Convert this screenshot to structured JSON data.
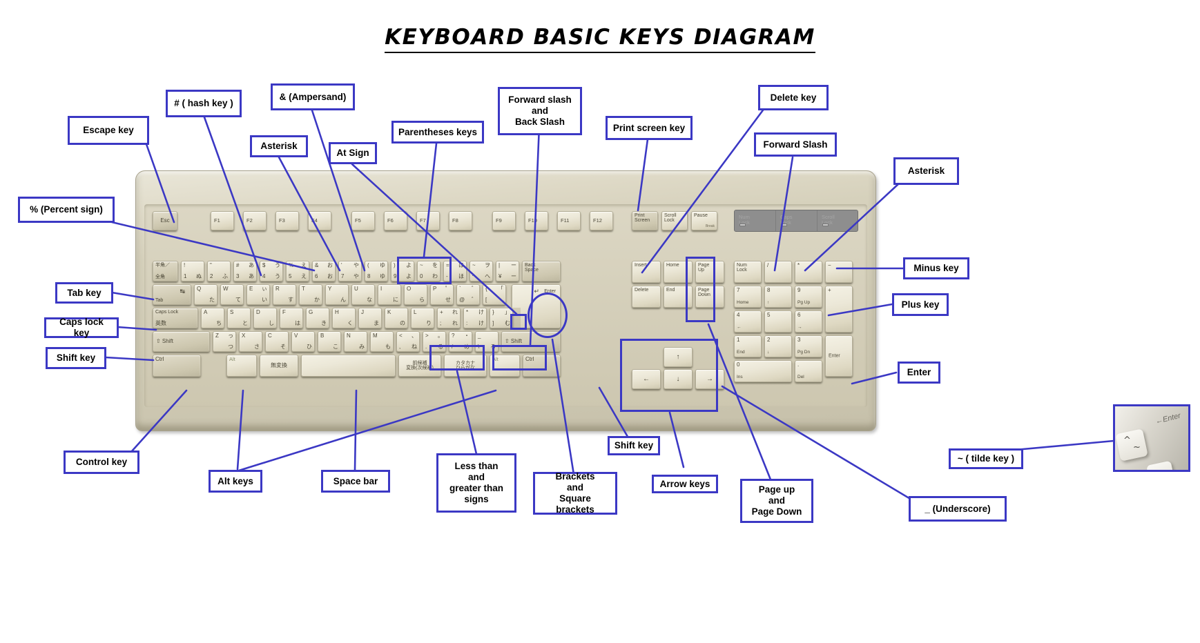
{
  "title": "KEYBOARD BASIC KEYS DIAGRAM",
  "diagram": {
    "subject": "Japanese 106-key beige desktop keyboard",
    "accent_color": "#3b38c4",
    "keyboard_color": "#d6d1bc",
    "key_color": "#ece8d8"
  },
  "labels": [
    {
      "id": "escape-key",
      "text": "Escape key"
    },
    {
      "id": "hash-key",
      "text": "# ( hash key )"
    },
    {
      "id": "ampersand",
      "text": "& (Ampersand)"
    },
    {
      "id": "asterisk-left",
      "text": "Asterisk"
    },
    {
      "id": "at-sign",
      "text": "At Sign"
    },
    {
      "id": "parentheses-keys",
      "text": "Parentheses keys"
    },
    {
      "id": "forward-back-slash",
      "text": "Forward slash\nand\nBack Slash"
    },
    {
      "id": "print-screen-key",
      "text": "Print screen key"
    },
    {
      "id": "delete-key",
      "text": "Delete key"
    },
    {
      "id": "forward-slash",
      "text": "Forward Slash"
    },
    {
      "id": "asterisk-right",
      "text": "Asterisk"
    },
    {
      "id": "percent-sign",
      "text": "% (Percent sign)"
    },
    {
      "id": "minus-key",
      "text": "Minus key"
    },
    {
      "id": "tab-key",
      "text": "Tab key"
    },
    {
      "id": "plus-key",
      "text": "Plus key"
    },
    {
      "id": "caps-lock-key",
      "text": "Caps lock key"
    },
    {
      "id": "shift-key-left",
      "text": "Shift key"
    },
    {
      "id": "enter-key",
      "text": "Enter"
    },
    {
      "id": "control-key",
      "text": "Control key"
    },
    {
      "id": "shift-key-right",
      "text": "Shift key"
    },
    {
      "id": "tilde-key",
      "text": "~ ( tilde key )"
    },
    {
      "id": "alt-keys",
      "text": "Alt keys"
    },
    {
      "id": "space-bar",
      "text": "Space bar"
    },
    {
      "id": "less-greater-than",
      "text": "Less than\nand\ngreater than\nsigns"
    },
    {
      "id": "brackets",
      "text": "Brackets\nand\nSquare brackets"
    },
    {
      "id": "arrow-keys",
      "text": "Arrow keys"
    },
    {
      "id": "page-up-down",
      "text": "Page up\nand\nPage Down"
    },
    {
      "id": "underscore",
      "text": "_ (Underscore)"
    }
  ],
  "keyboard": {
    "function_row": [
      {
        "label": "Esc"
      },
      {
        "label": "F1"
      },
      {
        "label": "F2"
      },
      {
        "label": "F3"
      },
      {
        "label": "F4"
      },
      {
        "label": "F5"
      },
      {
        "label": "F6"
      },
      {
        "label": "F7"
      },
      {
        "label": "F8"
      },
      {
        "label": "F9"
      },
      {
        "label": "F10"
      },
      {
        "label": "F11"
      },
      {
        "label": "F12"
      },
      {
        "label": "Print\nScreen"
      },
      {
        "label": "Scroll\nLock"
      },
      {
        "label": "Pause"
      }
    ],
    "pause_sublabel": "Break",
    "led_panel": [
      {
        "label": "Num\nLock"
      },
      {
        "label": "Caps\nLock"
      },
      {
        "label": "Scroll\nLock"
      }
    ],
    "number_row": [
      {
        "tl": "半角／",
        "bl": "全角"
      },
      {
        "tl": "!",
        "bl": "1",
        "br": "ぬ"
      },
      {
        "tl": "\"",
        "bl": "2",
        "br": "ふ"
      },
      {
        "tl": "#",
        "tr": "あ",
        "bl": "3",
        "br": "あ"
      },
      {
        "tl": "$",
        "tr": "う",
        "bl": "4",
        "br": "う"
      },
      {
        "tl": "%",
        "tr": "え",
        "bl": "5",
        "br": "え"
      },
      {
        "tl": "&",
        "tr": "お",
        "bl": "6",
        "br": "お"
      },
      {
        "tl": "'",
        "tr": "や",
        "bl": "7",
        "br": "や"
      },
      {
        "tl": "(",
        "tr": "ゆ",
        "bl": "8",
        "br": "ゆ"
      },
      {
        "tl": ")",
        "tr": "よ",
        "bl": "9",
        "br": "よ"
      },
      {
        "tl": "~",
        "tr": "を",
        "bl": "0",
        "br": "わ"
      },
      {
        "tl": "=",
        "tr": "ほ",
        "bl": "-",
        "br": "ほ"
      },
      {
        "tl": "~",
        "tr": "ヲ",
        "bl": "^",
        "br": "へ"
      },
      {
        "tl": "|",
        "tr": "ー",
        "bl": "¥",
        "br": "ー"
      },
      {
        "label": "Back\nSpace"
      }
    ],
    "tab_row": [
      {
        "label": "Tab"
      },
      {
        "tl": "Q",
        "br": "た"
      },
      {
        "tl": "W",
        "br": "て"
      },
      {
        "tl": "E",
        "tr": "ぃ",
        "br": "い"
      },
      {
        "tl": "R",
        "br": "す"
      },
      {
        "tl": "T",
        "br": "か"
      },
      {
        "tl": "Y",
        "br": "ん"
      },
      {
        "tl": "U",
        "br": "な"
      },
      {
        "tl": "I",
        "br": "に"
      },
      {
        "tl": "O",
        "br": "ら"
      },
      {
        "tl": "P",
        "tr": "゜",
        "br": "せ"
      },
      {
        "tl": "`",
        "tr": "゛",
        "bl": "@",
        "br": "゛"
      },
      {
        "tl": "{",
        "tr": "「",
        "bl": "[",
        "br": "゜"
      },
      {
        "label": "Enter"
      }
    ],
    "home_row": [
      {
        "label": "Caps Lock",
        "sub": "英数"
      },
      {
        "tl": "A",
        "br": "ち"
      },
      {
        "tl": "S",
        "br": "と"
      },
      {
        "tl": "D",
        "br": "し"
      },
      {
        "tl": "F",
        "br": "は"
      },
      {
        "tl": "G",
        "br": "き"
      },
      {
        "tl": "H",
        "br": "く"
      },
      {
        "tl": "J",
        "br": "ま"
      },
      {
        "tl": "K",
        "br": "の"
      },
      {
        "tl": "L",
        "br": "り"
      },
      {
        "tl": "+",
        "tr": "れ",
        "bl": ";",
        "br": "れ"
      },
      {
        "tl": "*",
        "tr": "け",
        "bl": ":",
        "br": "け"
      },
      {
        "tl": "}",
        "tr": "」",
        "bl": "]",
        "br": "む"
      }
    ],
    "shift_row": [
      {
        "label": "⇧ Shift"
      },
      {
        "tl": "Z",
        "tr": "っ",
        "br": "つ"
      },
      {
        "tl": "X",
        "br": "さ"
      },
      {
        "tl": "C",
        "br": "そ"
      },
      {
        "tl": "V",
        "br": "ひ"
      },
      {
        "tl": "B",
        "br": "こ"
      },
      {
        "tl": "N",
        "br": "み"
      },
      {
        "tl": "M",
        "br": "も"
      },
      {
        "tl": "<",
        "tr": "、",
        "bl": ",",
        "br": "ね"
      },
      {
        "tl": ">",
        "tr": "。",
        "bl": ".",
        "br": "る"
      },
      {
        "tl": "?",
        "tr": "・",
        "bl": "/",
        "br": "め"
      },
      {
        "tl": "_",
        "tr": "",
        "bl": "\\",
        "br": "ろ"
      },
      {
        "label": "⇧ Shift"
      }
    ],
    "bottom_row": [
      {
        "label": "Ctrl"
      },
      {
        "label": "Alt"
      },
      {
        "label": "無変換"
      },
      {
        "label": ""
      },
      {
        "label": "前候補\n変換(次候補)"
      },
      {
        "label": "カタカナ\nひらがな"
      },
      {
        "label": "Alt"
      },
      {
        "label": "Ctrl"
      }
    ],
    "nav_cluster": [
      {
        "label": "Insert"
      },
      {
        "label": "Home"
      },
      {
        "label": "Page\nUp"
      },
      {
        "label": "Delete"
      },
      {
        "label": "End"
      },
      {
        "label": "Page\nDown"
      }
    ],
    "arrow_cluster": [
      {
        "label": "↑"
      },
      {
        "label": "←"
      },
      {
        "label": "↓"
      },
      {
        "label": "→"
      }
    ],
    "numpad": [
      {
        "label": "Num\nLock"
      },
      {
        "label": "/"
      },
      {
        "label": "*"
      },
      {
        "label": "−"
      },
      {
        "tl": "7",
        "bl": "Home"
      },
      {
        "tl": "8",
        "bl": "↑"
      },
      {
        "tl": "9",
        "bl": "Pg Up"
      },
      {
        "label": "+"
      },
      {
        "tl": "4",
        "bl": "←"
      },
      {
        "tl": "5",
        "bl": ""
      },
      {
        "tl": "6",
        "bl": "→"
      },
      {
        "tl": "1",
        "bl": "End"
      },
      {
        "tl": "2",
        "bl": "↓"
      },
      {
        "tl": "3",
        "bl": "Pg Dn"
      },
      {
        "label": "Enter"
      },
      {
        "tl": "0",
        "bl": "Ins"
      },
      {
        "tl": ".",
        "bl": "Del"
      }
    ]
  },
  "tilde_inset": {
    "key_glyph": "^",
    "key_glyph_2": "~",
    "enter_label": "Enter"
  }
}
